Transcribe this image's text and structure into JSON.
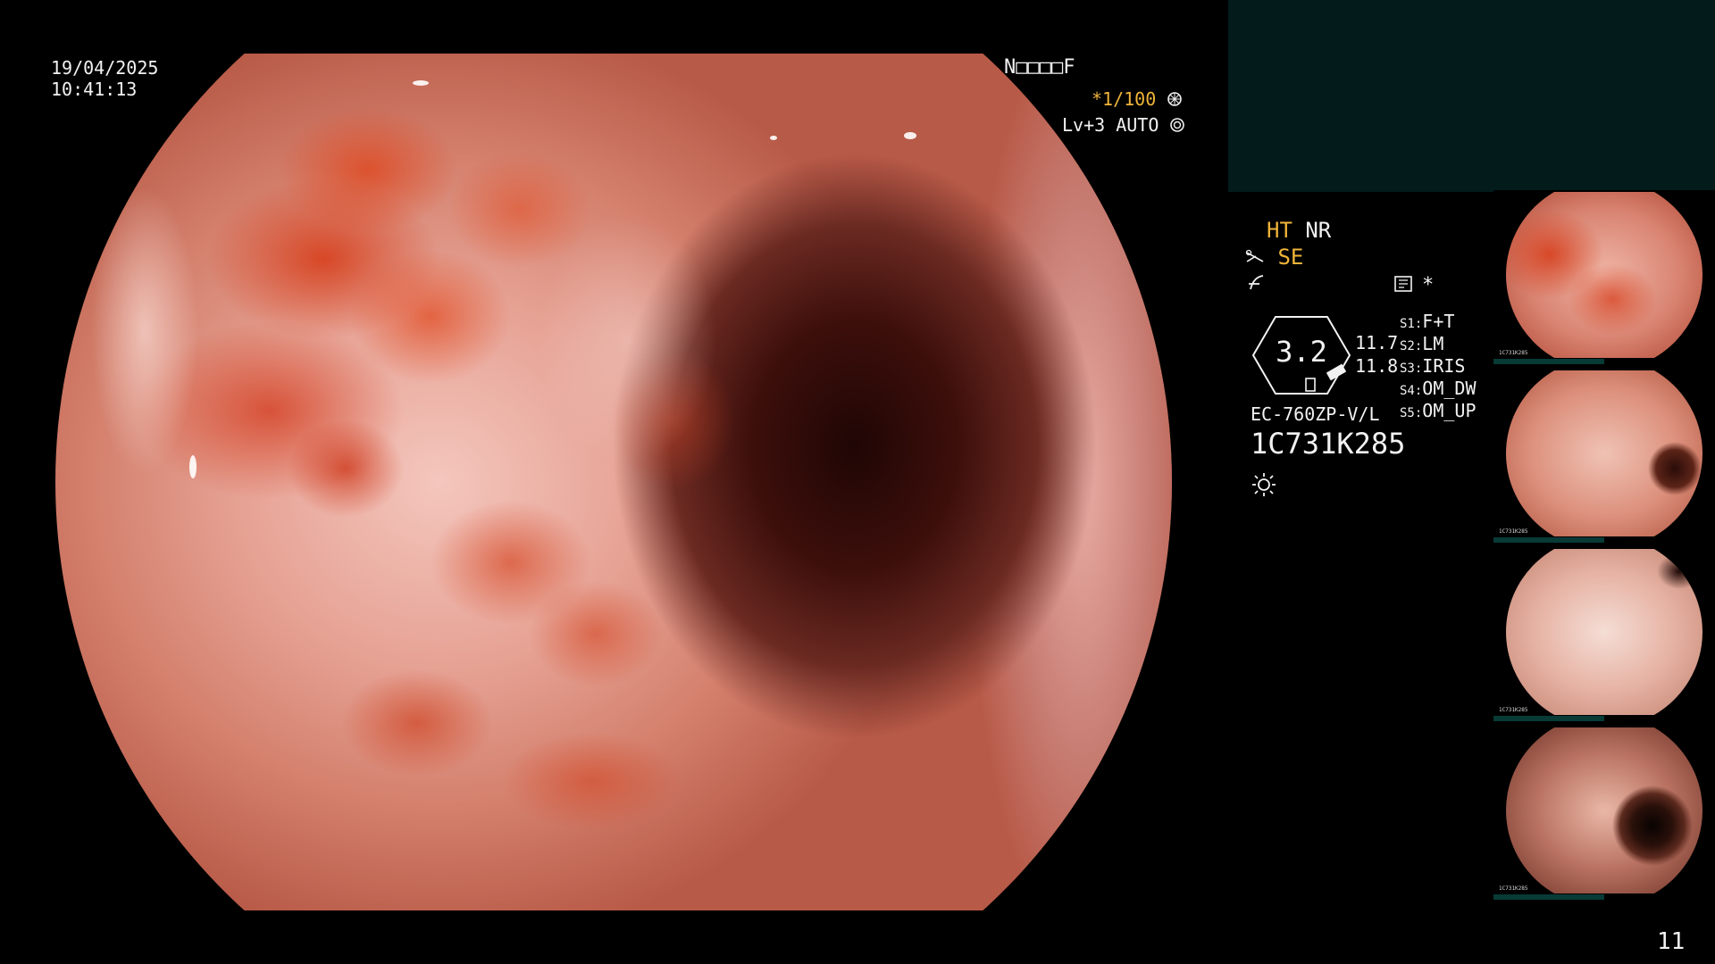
{
  "overlay": {
    "date": "19/04/2025",
    "time": "10:41:13",
    "mode_code": "N□□□□F",
    "shutter": "*1/100",
    "level": "Lv+3",
    "iris_mode": "AUTO"
  },
  "settings": {
    "ht": "HT",
    "nr": "NR",
    "se": "SE",
    "asterisk": "*"
  },
  "scope": {
    "gauge_value": "3.2",
    "value_1": "11.7",
    "value_2": "11.8",
    "model": "EC-760ZP-V/L",
    "serial": "1C731K285"
  },
  "switches": [
    {
      "key": "S1:",
      "value": "F+T"
    },
    {
      "key": "S2:",
      "value": "LM"
    },
    {
      "key": "S3:",
      "value": "IRIS"
    },
    {
      "key": "S4:",
      "value": "OM_DW"
    },
    {
      "key": "S5:",
      "value": "OM_UP"
    }
  ],
  "thumbnails": [
    {
      "label": "1C731K285"
    },
    {
      "label": "1C731K285"
    },
    {
      "label": "1C731K285"
    },
    {
      "label": "1C731K285"
    }
  ],
  "page_number": "11",
  "colors": {
    "accent_amber": "#f0b43a",
    "panel_teal": "#031b1b",
    "text": "#f2f2f2"
  },
  "icons": [
    "shutter-icon",
    "iris-icon",
    "scissors-icon",
    "curve-icon",
    "memory-card-icon",
    "lamp-icon"
  ]
}
